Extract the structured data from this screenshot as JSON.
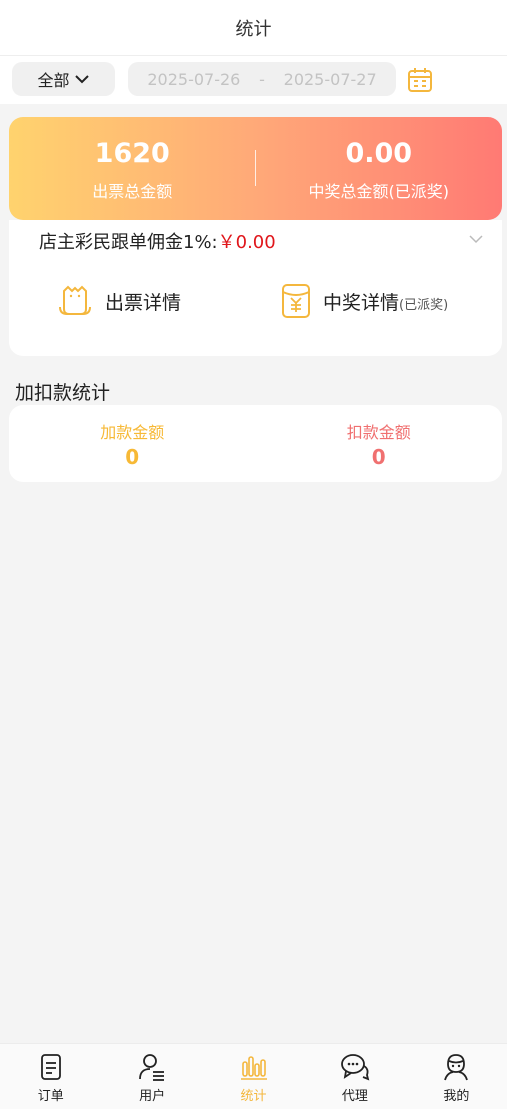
{
  "header": {
    "title": "统计"
  },
  "filter": {
    "scope": "全部",
    "date_start": "2025-07-26",
    "date_sep": "-",
    "date_end": "2025-07-27",
    "calendar_icon": "calendar-icon"
  },
  "summary": {
    "ticket_total": "1620",
    "ticket_label": "出票总金额",
    "prize_total": "0.00",
    "prize_label": "中奖总金额(已派奖)"
  },
  "detail": {
    "commission_label": "店主彩民跟单佣金1%:",
    "commission_amount": "￥0.00",
    "ticket_detail": "出票详情",
    "prize_detail": "中奖详情",
    "prize_detail_sub": "(已派奖)"
  },
  "adjust": {
    "title": "加扣款统计",
    "add_label": "加款金额",
    "add_value": "0",
    "deduct_label": "扣款金额",
    "deduct_value": "0"
  },
  "colors": {
    "accent": "#f4b73d",
    "deduct": "#f07070",
    "money_red": "#e0161b"
  },
  "tabs": [
    {
      "label": "订单",
      "icon": "order-icon"
    },
    {
      "label": "用户",
      "icon": "user-icon"
    },
    {
      "label": "统计",
      "icon": "stats-icon",
      "active": true
    },
    {
      "label": "代理",
      "icon": "agent-chat-icon"
    },
    {
      "label": "我的",
      "icon": "profile-icon"
    }
  ]
}
